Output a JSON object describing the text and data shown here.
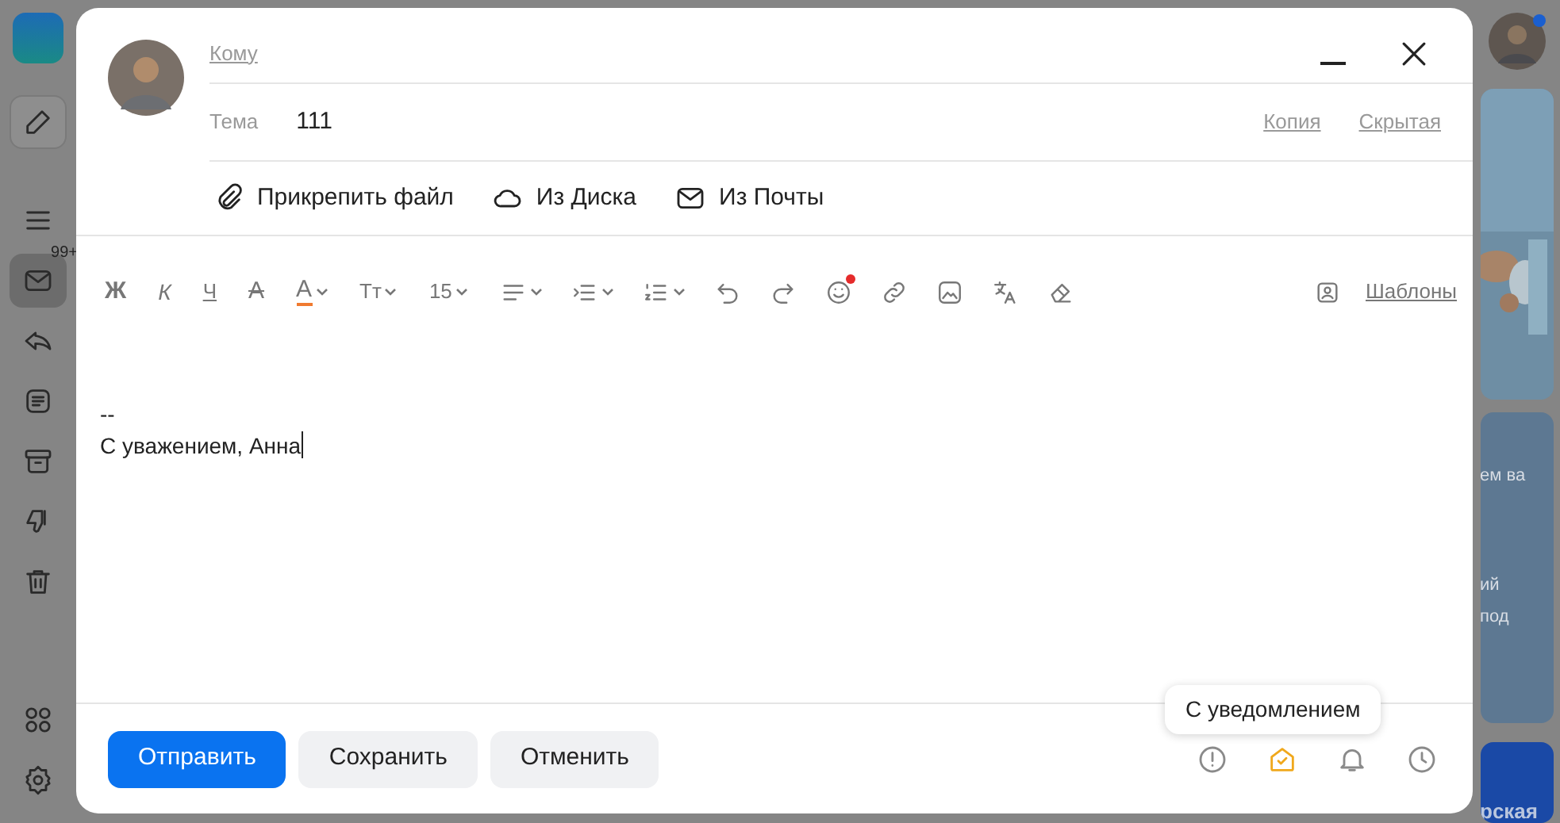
{
  "sidebar": {
    "items": [
      {
        "kind": "compose",
        "selected": false
      },
      {
        "kind": "menu",
        "selected": false
      },
      {
        "kind": "inbox",
        "selected": true,
        "badge": "99+"
      },
      {
        "kind": "sent",
        "selected": false
      },
      {
        "kind": "drafts",
        "selected": false
      },
      {
        "kind": "archive",
        "selected": false
      },
      {
        "kind": "spam",
        "selected": false
      },
      {
        "kind": "trash",
        "selected": false
      }
    ],
    "bottom_items": [
      {
        "kind": "apps"
      },
      {
        "kind": "settings"
      }
    ]
  },
  "right_panel": {
    "user_has_notification": true,
    "ad_texts": [
      "ем ва",
      "ий",
      "под"
    ],
    "ad_title": "рская"
  },
  "compose": {
    "to_label": "Кому",
    "subject_label": "Тема",
    "subject": "111",
    "cc": "Копия",
    "bcc": "Скрытая",
    "attach": [
      {
        "label": "Прикрепить файл"
      },
      {
        "label": "Из Диска"
      },
      {
        "label": "Из Почты"
      }
    ],
    "toolbar": [
      {
        "kind": "bold",
        "label": "Ж",
        "dropdown": false
      },
      {
        "kind": "italic",
        "label": "К",
        "dropdown": false
      },
      {
        "kind": "underline",
        "label": "Ч",
        "dropdown": false
      },
      {
        "kind": "strike",
        "label": "А",
        "dropdown": false
      },
      {
        "kind": "color",
        "label": "А",
        "dropdown": true
      },
      {
        "kind": "text",
        "label": "Тт",
        "dropdown": true
      },
      {
        "kind": "text",
        "label": "15",
        "dropdown": true
      },
      {
        "kind": "icon",
        "dropdown": true
      },
      {
        "kind": "icon",
        "dropdown": true
      },
      {
        "kind": "icon",
        "dropdown": true
      },
      {
        "kind": "icon",
        "dropdown": false
      },
      {
        "kind": "icon",
        "dropdown": false
      },
      {
        "kind": "icon",
        "dropdown": false,
        "dot": true
      },
      {
        "kind": "icon",
        "dropdown": false
      },
      {
        "kind": "icon",
        "dropdown": false
      },
      {
        "kind": "icon",
        "dropdown": false
      },
      {
        "kind": "icon",
        "dropdown": false
      }
    ],
    "templates": "Шаблоны",
    "body": [
      "--",
      "С уважением, Анна"
    ],
    "buttons": [
      {
        "label": "Отправить",
        "kind": "primary"
      },
      {
        "label": "Сохранить",
        "kind": "secondary"
      },
      {
        "label": "Отменить",
        "kind": "secondary"
      }
    ],
    "options": [
      {
        "selected": false
      },
      {
        "selected": true
      },
      {
        "selected": false
      },
      {
        "selected": false
      }
    ],
    "tooltip": "С уведомлением"
  }
}
